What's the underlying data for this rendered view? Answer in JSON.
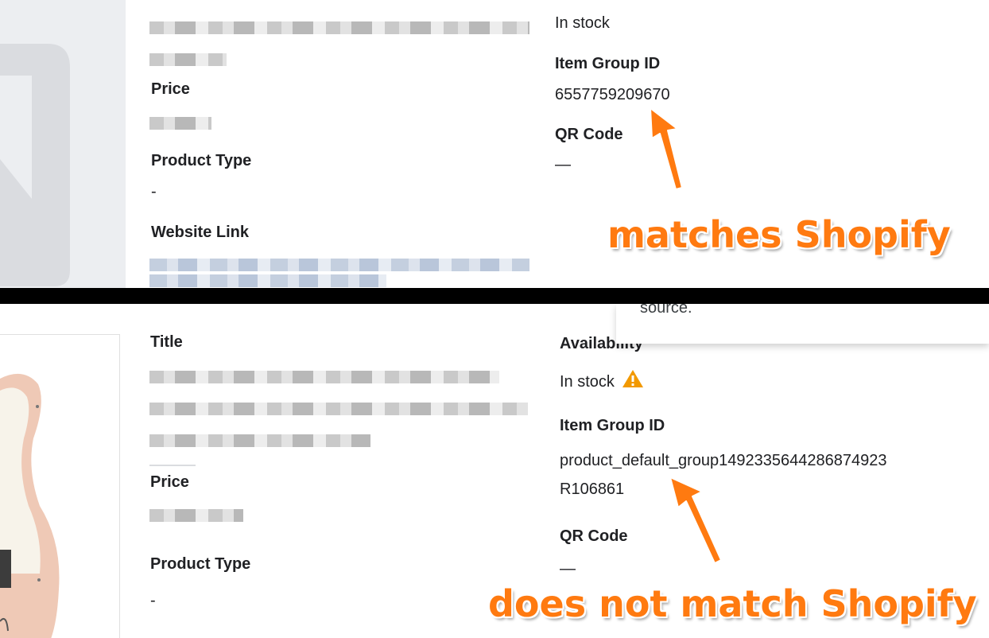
{
  "top": {
    "price_label": "Price",
    "product_type_label": "Product Type",
    "product_type_value": "-",
    "website_link_label": "Website Link",
    "availability_value": "In stock",
    "item_group_id_label": "Item Group ID",
    "item_group_id_value": "6557759209670",
    "qr_code_label": "QR Code",
    "qr_code_value": "—",
    "annotation": "matches Shopify"
  },
  "bottom": {
    "title_label": "Title",
    "price_label": "Price",
    "product_type_label": "Product Type",
    "product_type_value": "-",
    "availability_label": "Availability",
    "availability_value": "In stock",
    "item_group_id_label": "Item Group ID",
    "item_group_id_value_line1": "product_default_group1492335644286874923",
    "item_group_id_value_line2": "R106861",
    "qr_code_label": "QR Code",
    "qr_code_value": "—",
    "tooltip_text": "source.",
    "annotation": "does not match Shopify"
  },
  "icons": {
    "warning": "warning-triangle-icon",
    "arrow": "annotation-arrow-icon"
  },
  "colors": {
    "annotation": "#ff7a10",
    "warning": "#f29900",
    "divider": "#000000"
  }
}
